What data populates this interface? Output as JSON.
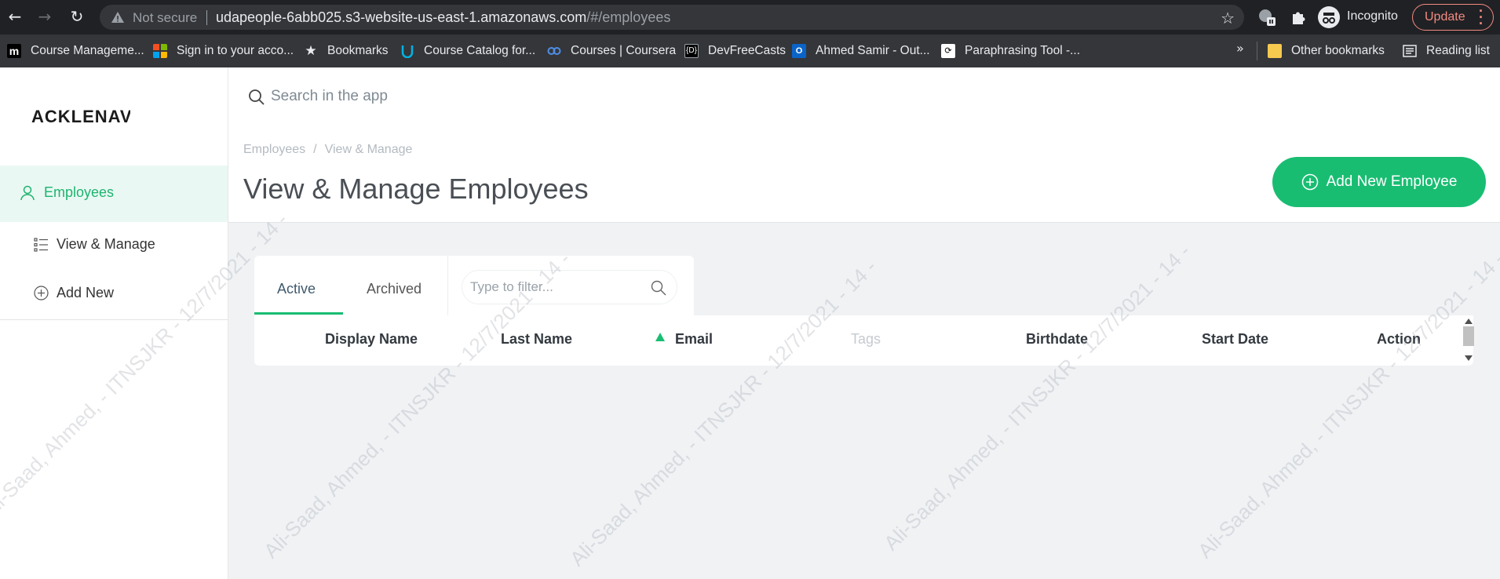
{
  "browser": {
    "security_label": "Not secure",
    "url_host": "udapeople-6abb025.s3-website-us-east-1.amazonaws.com",
    "url_path": "/#/employees",
    "profile_label": "Incognito",
    "update_label": "Update",
    "bookmarks": [
      {
        "label": "Course Manageme...",
        "icon": "moodle-icon",
        "color": "#000000"
      },
      {
        "label": "Sign in to your acco...",
        "icon": "microsoft-icon",
        "color": "#f25022"
      },
      {
        "label": "Bookmarks",
        "icon": "star-icon",
        "color": "#e8eaed"
      },
      {
        "label": "Course Catalog for...",
        "icon": "udacity-icon",
        "color": "#02b3e4"
      },
      {
        "label": "Courses | Coursera",
        "icon": "coursera-icon",
        "color": "#4e8ee8"
      },
      {
        "label": "DevFreeCasts",
        "icon": "devfreecasts-icon",
        "color": "#000000"
      },
      {
        "label": "Ahmed Samir - Out...",
        "icon": "outlook-icon",
        "color": "#0a64c8"
      },
      {
        "label": "Paraphrasing Tool -...",
        "icon": "paraphrasing-icon",
        "color": "#ffffff"
      }
    ],
    "other_bookmarks_label": "Other bookmarks",
    "reading_list_label": "Reading list"
  },
  "app": {
    "logo_text": "ACKLENAV",
    "sidebar": {
      "section_label": "Employees",
      "items": [
        {
          "label": "View & Manage",
          "icon": "list-icon"
        },
        {
          "label": "Add New",
          "icon": "plus-circle-icon"
        }
      ]
    },
    "search_placeholder": "Search in the app",
    "breadcrumb": [
      "Employees",
      "View & Manage"
    ],
    "page_title": "View & Manage Employees",
    "add_button_label": "Add New Employee",
    "tabs": [
      "Active",
      "Archived"
    ],
    "active_tab": "Active",
    "filter_placeholder": "Type to filter...",
    "columns": [
      "Display Name",
      "Last Name",
      "Email",
      "Tags",
      "Birthdate",
      "Start Date",
      "Action"
    ],
    "sorted_column": "Email",
    "accent_color": "#19bd72"
  },
  "watermark_text": "Ali-Saad, Ahmed, - ITNSJKR - 12/7/2021 - 14 -"
}
